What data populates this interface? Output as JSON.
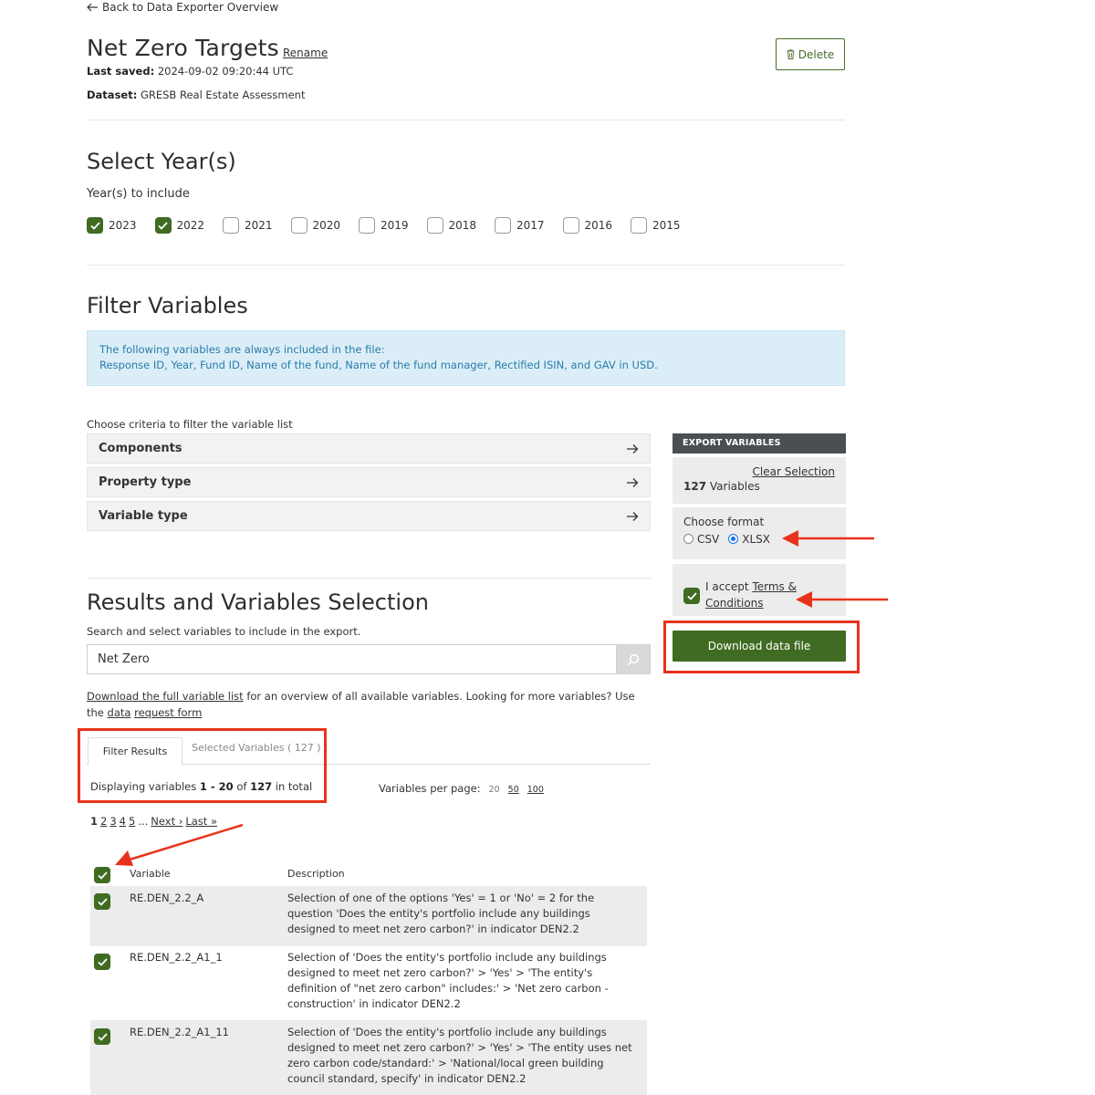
{
  "header": {
    "back_label": "Back to Data Exporter Overview",
    "title": "Net Zero Targets",
    "rename_label": "Rename",
    "last_saved_label": "Last saved:",
    "last_saved_value": "2024-09-02 09:20:44 UTC",
    "dataset_label": "Dataset:",
    "dataset_value": "GRESB Real Estate Assessment",
    "delete_label": "Delete"
  },
  "years_section": {
    "title": "Select Year(s)",
    "subtitle": "Year(s) to include",
    "years": [
      {
        "label": "2023",
        "checked": true
      },
      {
        "label": "2022",
        "checked": true
      },
      {
        "label": "2021",
        "checked": false
      },
      {
        "label": "2020",
        "checked": false
      },
      {
        "label": "2019",
        "checked": false
      },
      {
        "label": "2018",
        "checked": false
      },
      {
        "label": "2017",
        "checked": false
      },
      {
        "label": "2016",
        "checked": false
      },
      {
        "label": "2015",
        "checked": false
      }
    ]
  },
  "filter_section": {
    "title": "Filter Variables",
    "info_line1": "The following variables are always included in the file:",
    "info_line2": "Response ID, Year, Fund ID, Name of the fund, Name of the fund manager, Rectified ISIN, and GAV in USD.",
    "criteria_label": "Choose criteria to filter the variable list",
    "criteria": [
      "Components",
      "Property type",
      "Variable type"
    ]
  },
  "export_panel": {
    "heading": "EXPORT VARIABLES",
    "clear_label": "Clear Selection",
    "count_number": "127",
    "count_suffix": "Variables",
    "format_label": "Choose format",
    "format_options": [
      "CSV",
      "XLSX"
    ],
    "selected_format": "XLSX",
    "accept_prefix": "I accept",
    "terms_link_1": "Terms &",
    "terms_link_2": "Conditions",
    "download_label": "Download data file"
  },
  "results_section": {
    "title": "Results and Variables Selection",
    "subtitle": "Search and select variables to include in the export.",
    "search_value": "Net Zero",
    "help_link_1": "Download the full variable list",
    "help_text_mid": "for an overview of all available variables. Looking for more variables? Use the",
    "help_link_2a": "data",
    "help_link_2b": "request form",
    "tab_filter": "Filter Results",
    "tab_selected": "Selected Variables ( 127 )",
    "display_prefix": "Displaying variables",
    "display_range": "1 - 20",
    "display_of": "of",
    "display_total": "127",
    "display_suffix": "in total",
    "per_page_label": "Variables per page:",
    "per_page_options": [
      "20",
      "50",
      "100"
    ],
    "pager": {
      "pages": [
        "1",
        "2",
        "3",
        "4",
        "5"
      ],
      "dots": "...",
      "next": "Next ›",
      "last": "Last »"
    },
    "table": {
      "col_variable": "Variable",
      "col_description": "Description",
      "rows": [
        {
          "variable": "RE.DEN_2.2_A",
          "description": "Selection of one of the options 'Yes' = 1 or 'No' = 2 for the question 'Does the entity's portfolio include any buildings designed to meet net zero carbon?' in indicator DEN2.2",
          "checked": true
        },
        {
          "variable": "RE.DEN_2.2_A1_1",
          "description": "Selection of 'Does the entity's portfolio include any buildings designed to meet net zero carbon?' > 'Yes' > 'The entity's definition of \"net zero carbon\" includes:' > 'Net zero carbon - construction' in indicator DEN2.2",
          "checked": true
        },
        {
          "variable": "RE.DEN_2.2_A1_11",
          "description": "Selection of 'Does the entity's portfolio include any buildings designed to meet net zero carbon?' > 'Yes' > 'The entity uses net zero carbon code/standard:' > 'National/local green building council standard, specify' in indicator DEN2.2",
          "checked": true
        }
      ]
    }
  },
  "colors": {
    "brand_green": "#3f6b22",
    "annotation_red": "#e8331c",
    "info_blue": "#2a7ba8"
  }
}
